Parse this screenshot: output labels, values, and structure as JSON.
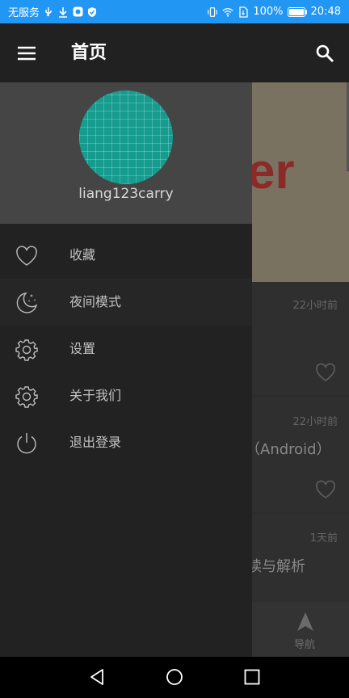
{
  "status_bar": {
    "carrier": "无服务",
    "battery": "100%",
    "time": "20:48"
  },
  "toolbar": {
    "title": "首页",
    "menu_icon": "hamburger-menu-icon",
    "search_icon": "search-icon"
  },
  "background": {
    "banner_text": "er",
    "cards": [
      {
        "time": "22小时前",
        "title": ""
      },
      {
        "time": "22小时前",
        "title": "（Android）"
      },
      {
        "time": "1天前",
        "title": "读与解析"
      }
    ],
    "bottom_nav_label": "导航"
  },
  "drawer": {
    "username": "liang123carry",
    "items": [
      {
        "label": "收藏",
        "icon": "heart-icon"
      },
      {
        "label": "夜间模式",
        "icon": "moon-icon"
      },
      {
        "label": "设置",
        "icon": "gear-icon"
      },
      {
        "label": "关于我们",
        "icon": "gear-icon"
      },
      {
        "label": "退出登录",
        "icon": "power-icon"
      }
    ]
  },
  "colors": {
    "status_bar": "#2196f3",
    "toolbar": "#212121",
    "drawer": "#222222",
    "drawer_header": "#454545",
    "avatar": "#169c8e"
  }
}
